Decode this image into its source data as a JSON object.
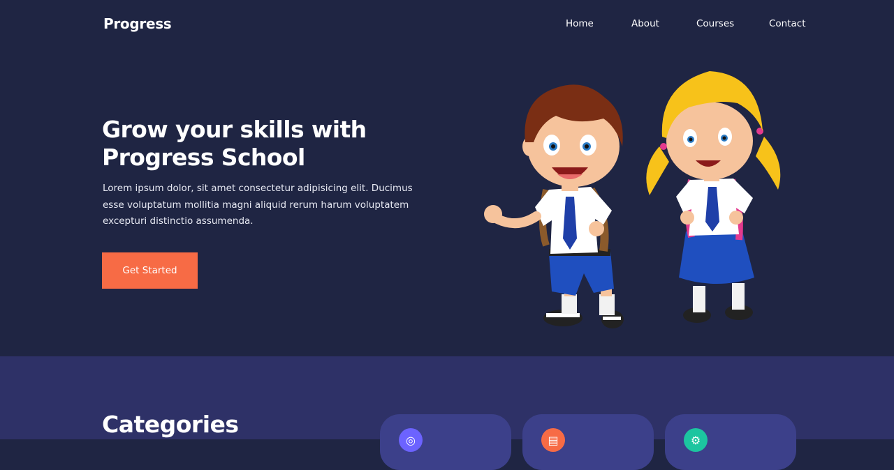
{
  "nav": {
    "logo": "Progress",
    "links": [
      "Home",
      "About",
      "Courses",
      "Contact"
    ]
  },
  "hero": {
    "title_line1": "Grow your skills with",
    "title_line2": "Progress School",
    "description": "Lorem ipsum dolor, sit amet consectetur adipisicing elit. Ducimus esse voluptatum mollitia magni aliquid rerum harum voluptatem excepturi distinctio assumenda.",
    "cta_label": "Get Started",
    "illustration": "school-kids-illustration"
  },
  "categories": {
    "title": "Categories",
    "cards": [
      {
        "icon": "globe-icon",
        "color": "#6c63ff"
      },
      {
        "icon": "book-icon",
        "color": "#f76b45"
      },
      {
        "icon": "gear-icon",
        "color": "#1cc5a0"
      }
    ]
  },
  "colors": {
    "hero_bg": "#1f2543",
    "section_bg": "#2e3167",
    "card_bg": "#3c408a",
    "accent": "#f76b45"
  }
}
